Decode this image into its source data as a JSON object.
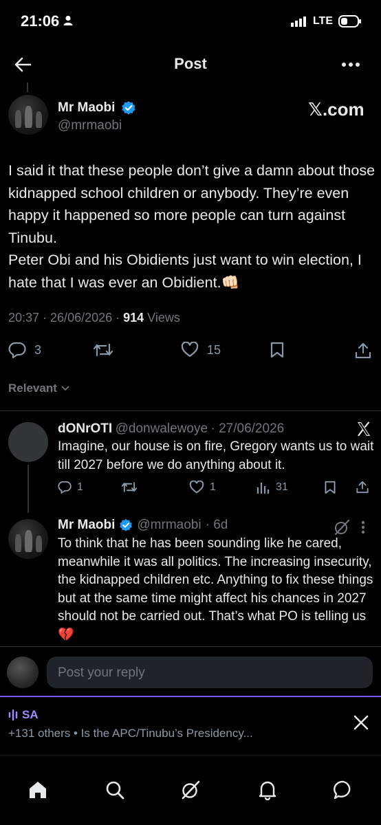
{
  "status_bar": {
    "time": "21:06",
    "network": "LTE"
  },
  "header": {
    "title": "Post"
  },
  "post": {
    "author": "Mr Maobi",
    "handle": "@mrmaobi",
    "source_brand": "𝕏.com",
    "text": "I said it that these people don’t give a damn about those kidnapped school children or anybody. They’re even happy it happened so more people can turn against Tinubu.\nPeter Obi and his Obidients just want to win election, I hate that I was ever an Obidient.👊🏻",
    "timestamp": "20:37 · 26/06/2026 · ",
    "views_count": "914",
    "views_label": " Views",
    "replies": "3",
    "likes": "15"
  },
  "sort": {
    "label": "Relevant"
  },
  "replies": [
    {
      "author": "dONrOTI",
      "handle": "@donwalewoye",
      "date": "· 27/06/2026",
      "text": "Imagine, our house is on fire, Gregory wants us to wait till 2027 before we do anything about it.",
      "replies": "1",
      "likes": "1",
      "views": "31"
    },
    {
      "author": "Mr Maobi",
      "handle": "@mrmaobi",
      "date": "· 6d",
      "text": "To think that he has been sounding like he cared, meanwhile it was all politics. The increasing insecurity, the kidnapped children etc. Anything to fix these things but at the same time might affect his chances in 2027 should not be carried out. That’s what PO is telling us 💔"
    }
  ],
  "composer": {
    "placeholder": "Post your reply"
  },
  "banner": {
    "title": "SA",
    "text": "+131 others • Is the APC/Tinubu’s Presidency..."
  },
  "colors": {
    "verified": "#1d9bf0",
    "background": "#000000",
    "accent_purple": "#7856ff"
  }
}
